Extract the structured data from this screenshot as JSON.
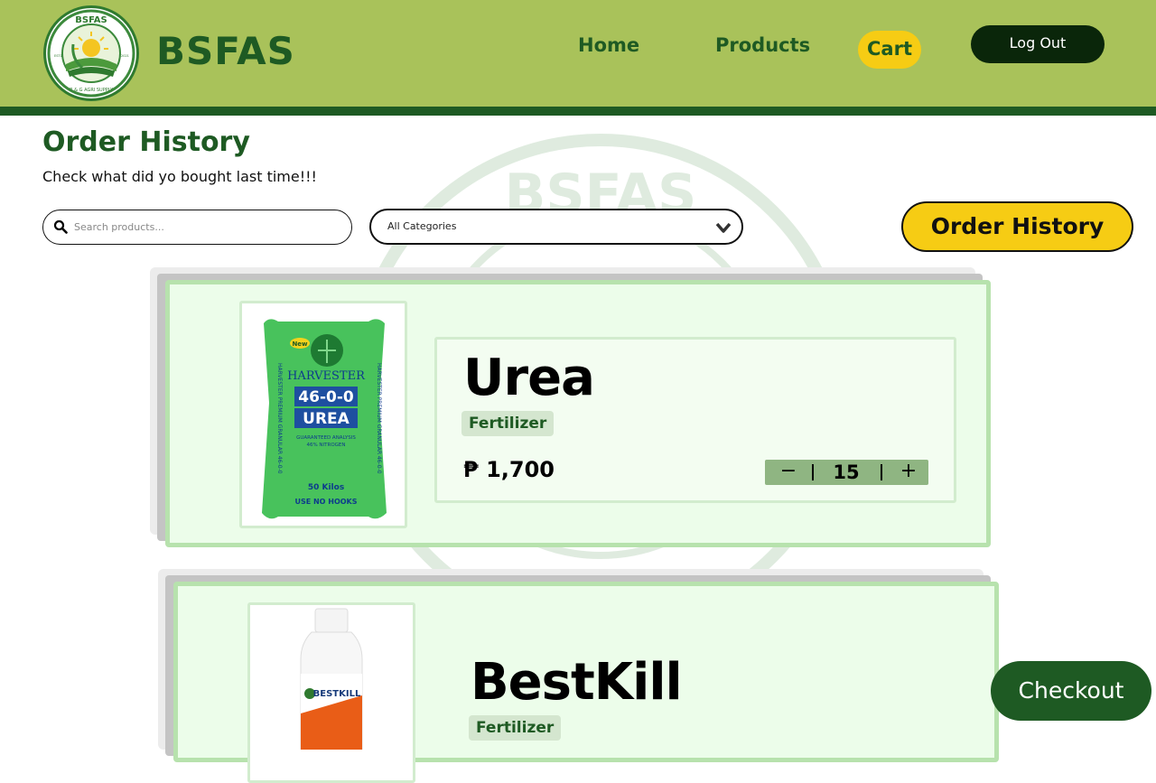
{
  "brand": {
    "name": "BSFAS",
    "logo_text_top": "BSFAS",
    "logo_text_bottom": "R & G AGRI SUPPLY",
    "logo_estd": "ESTD",
    "logo_year": "2021"
  },
  "nav": {
    "home": "Home",
    "products": "Products",
    "cart": "Cart",
    "logout": "Log Out"
  },
  "page": {
    "title": "Order History",
    "subtitle": "Check what did yo bought last time!!!"
  },
  "search": {
    "placeholder": "Search products...",
    "value": ""
  },
  "category_select": {
    "selected": "All Categories"
  },
  "order_history_button": "Order History",
  "orders": [
    {
      "name": "Urea",
      "category": "Fertilizer",
      "currency": "₱",
      "price": "1,700",
      "quantity": "15",
      "package": {
        "badge": "New",
        "brand": "HARVESTER",
        "formula": "46-0-0",
        "product": "UREA",
        "analysis": "GUARANTEED ANALYSIS",
        "nitrogen": "46% NITROGEN",
        "weight": "50 Kilos",
        "note": "USE NO HOOKS",
        "side": "HARVESTER PREMIUM GRANULAR 46-0-0"
      }
    },
    {
      "name": "BestKill",
      "category": "Fertilizer",
      "package": {
        "label": "BESTKILL"
      }
    }
  ],
  "checkout": "Checkout",
  "colors": {
    "header": "#a9c25a",
    "dark_green": "#1e5a23",
    "accent_yellow": "#f6cc14",
    "card_bg": "#ecfdea"
  }
}
